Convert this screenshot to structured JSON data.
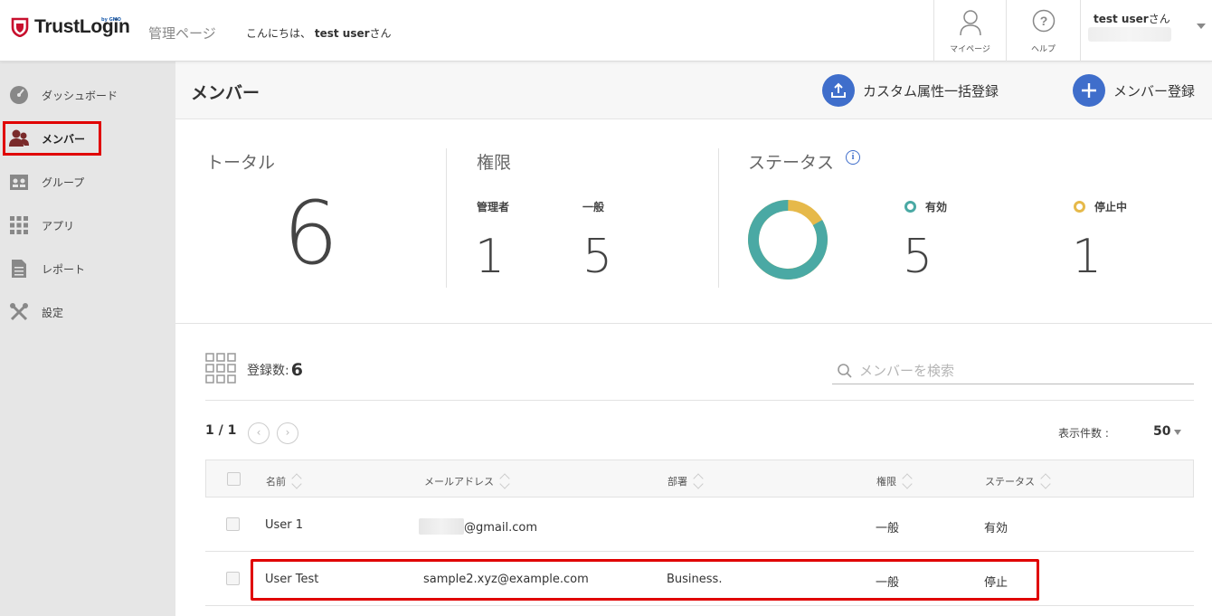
{
  "header": {
    "logo_text": "TrustLogin",
    "logo_sub": "by GMO",
    "admin_page": "管理ページ",
    "greeting_prefix": "こんにちは、",
    "greeting_user": "test user",
    "greeting_suffix": "さん",
    "mypage_label": "マイページ",
    "help_label": "ヘルプ",
    "user_name": "test user",
    "user_suffix": "さん"
  },
  "sidebar": {
    "items": [
      {
        "label": "ダッシュボード",
        "icon": "dashboard-icon"
      },
      {
        "label": "メンバー",
        "icon": "members-icon"
      },
      {
        "label": "グループ",
        "icon": "group-icon"
      },
      {
        "label": "アプリ",
        "icon": "apps-icon"
      },
      {
        "label": "レポート",
        "icon": "report-icon"
      },
      {
        "label": "設定",
        "icon": "settings-icon"
      }
    ],
    "active": "メンバー"
  },
  "main": {
    "title": "メンバー",
    "bulk_button": "カスタム属性一括登録",
    "add_button": "メンバー登録"
  },
  "stats": {
    "total_label": "トータル",
    "total_value": "6",
    "role_label": "権限",
    "admin_label": "管理者",
    "admin_value": "1",
    "general_label": "一般",
    "general_value": "5",
    "status_label": "ステータス",
    "active_label": "有効",
    "active_value": "5",
    "suspended_label": "停止中",
    "suspended_value": "1",
    "active_fraction": 0.833,
    "active_color": "#4aa9a4",
    "suspended_color": "#e6b94a"
  },
  "list": {
    "reg_label": "登録数:",
    "reg_count": "6",
    "search_placeholder": "メンバーを検索",
    "pager": "1 / 1",
    "prev": "‹",
    "next": "›",
    "per_page_label": "表示件数 :",
    "per_page_value": "50",
    "columns": [
      "名前",
      "メールアドレス",
      "部署",
      "権限",
      "ステータス"
    ],
    "rows": [
      {
        "name": "User 1",
        "email": "@gmail.com",
        "dept": "",
        "role": "一般",
        "status": "有効"
      },
      {
        "name": "User Test",
        "email": "sample2.xyz@example.com",
        "dept": "Business.",
        "role": "一般",
        "status": "停止"
      }
    ]
  },
  "colors": {
    "accent": "#3f6ecb",
    "highlight": "#e00000",
    "brand_red": "#c8102e"
  }
}
